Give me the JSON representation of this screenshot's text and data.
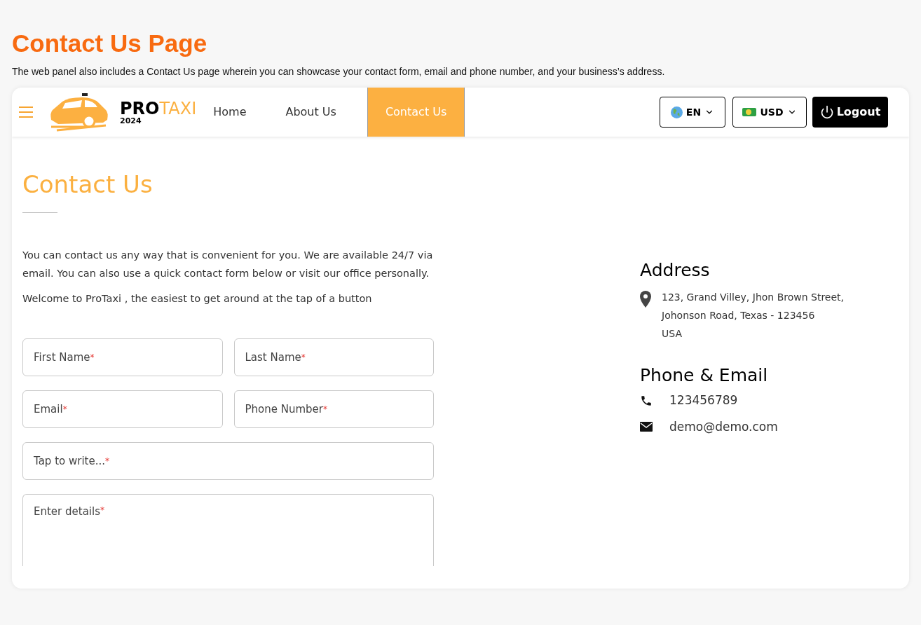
{
  "page": {
    "title": "Contact Us Page",
    "description": "The web panel also includes a Contact Us page wherein you can showcase your contact form, email and phone number, and your business’s address."
  },
  "navbar": {
    "brand": {
      "name_dark": "PRO",
      "name_light": "TAXI",
      "year": "2024"
    },
    "links": [
      {
        "label": "Home",
        "selected": false
      },
      {
        "label": "About Us",
        "selected": false
      },
      {
        "label": "Contact Us",
        "selected": true
      }
    ],
    "language": "EN",
    "currency": "USD",
    "logout": "Logout"
  },
  "contact": {
    "title": "Contact Us",
    "intro": "You can contact us any way that is convenient for you. We are available 24/7 via email. You can also use a quick contact form below or visit our office personally.",
    "welcome": "Welcome to ProTaxi , the easiest to get around at the tap of a button",
    "form": [
      {
        "kind": "half",
        "placeholder": "First Name",
        "mark": "*"
      },
      {
        "kind": "half",
        "placeholder": "Last Name",
        "mark": "*"
      },
      {
        "kind": "half",
        "placeholder": "Email",
        "mark": "*"
      },
      {
        "kind": "half",
        "placeholder": "Phone Number",
        "mark": "*"
      },
      {
        "kind": "full",
        "placeholder": "Tap to write...",
        "mark": "*"
      },
      {
        "kind": "textarea",
        "placeholder": "Enter details",
        "mark": "*"
      }
    ]
  },
  "address": {
    "title": "Address",
    "lines": [
      "123, Grand Villey, Jhon Brown Street,",
      "Johonson Road, Texas - 123456",
      "USA"
    ]
  },
  "phone_email": {
    "title": "Phone & Email",
    "phone": "123456789",
    "email": "demo@demo.com"
  }
}
